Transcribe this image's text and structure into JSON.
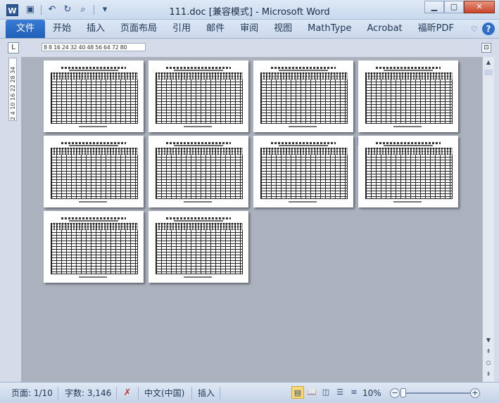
{
  "window": {
    "title": "111.doc [兼容模式] - Microsoft Word",
    "app_icon_letter": "W",
    "minimize": "▭",
    "maximize": "□",
    "close": "✕"
  },
  "quick_access": [
    {
      "name": "save-icon",
      "glyph": "💾"
    },
    {
      "name": "undo-icon",
      "glyph": "↶"
    },
    {
      "name": "redo-icon",
      "glyph": "↻"
    },
    {
      "name": "print-preview-icon",
      "glyph": "🔍"
    },
    {
      "name": "customize-qat-icon",
      "glyph": "▾"
    }
  ],
  "ribbon": {
    "file_tab": "文件",
    "tabs": [
      "开始",
      "插入",
      "页面布局",
      "引用",
      "邮件",
      "审阅",
      "视图",
      "MathType",
      "Acrobat",
      "福昕PDF"
    ],
    "minimize_glyph": "♡",
    "help_glyph": "?"
  },
  "ruler": {
    "tab_selector": "L",
    "horizontal_text": "8   8  16  24 32 40 48 56 64 72 80",
    "vertical_text": "2  4  10  16  22  28  34"
  },
  "document": {
    "page_count": 10
  },
  "statusbar": {
    "page": "页面: 1/10",
    "words": "字数: 3,146",
    "language": "中文(中国)",
    "insert_mode": "插入",
    "zoom": "10%",
    "zoom_minus": "−",
    "zoom_plus": "+"
  }
}
